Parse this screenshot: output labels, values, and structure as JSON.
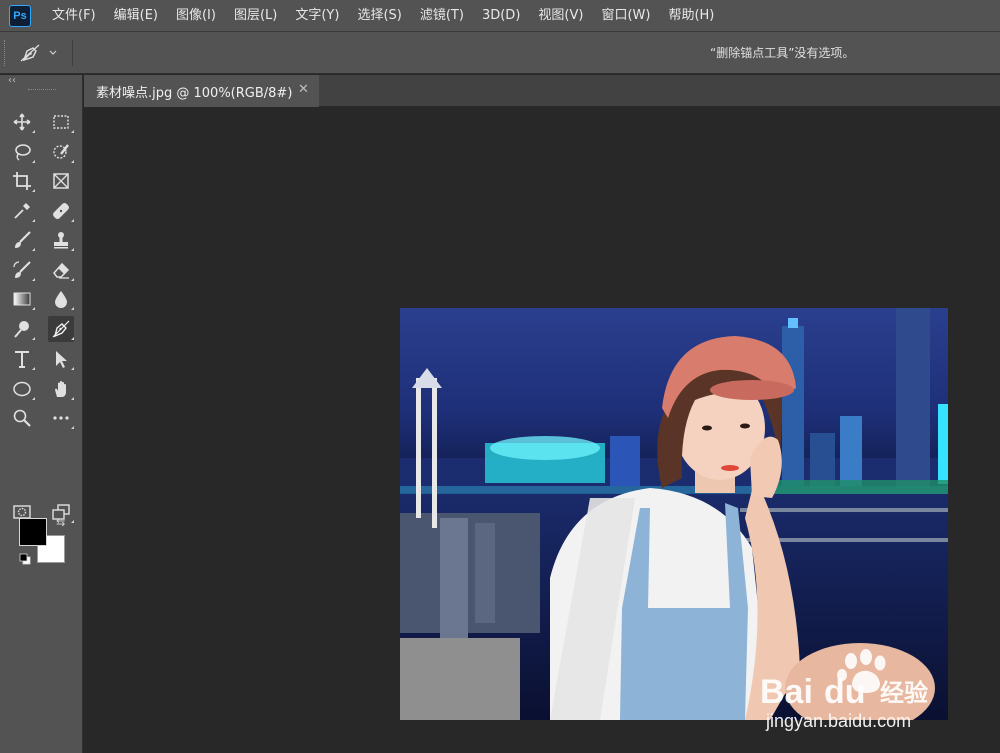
{
  "app": {
    "logo_text": "Ps"
  },
  "menu": [
    {
      "label": "文件(F)"
    },
    {
      "label": "编辑(E)"
    },
    {
      "label": "图像(I)"
    },
    {
      "label": "图层(L)"
    },
    {
      "label": "文字(Y)"
    },
    {
      "label": "选择(S)"
    },
    {
      "label": "滤镜(T)"
    },
    {
      "label": "3D(D)"
    },
    {
      "label": "视图(V)"
    },
    {
      "label": "窗口(W)"
    },
    {
      "label": "帮助(H)"
    }
  ],
  "options_bar": {
    "tool_icon": "pen-tool-icon",
    "message": "“删除锚点工具”没有选项。"
  },
  "toolbar": {
    "collapse_label": "‹‹",
    "tools": [
      "move-tool-icon",
      "marquee-tool-icon",
      "lasso-tool-icon",
      "quick-select-tool-icon",
      "crop-tool-icon",
      "frame-tool-icon",
      "eyedropper-tool-icon",
      "healing-brush-tool-icon",
      "brush-tool-icon",
      "clone-stamp-tool-icon",
      "history-brush-tool-icon",
      "eraser-tool-icon",
      "gradient-tool-icon",
      "blur-tool-icon",
      "dodge-tool-icon",
      "pen-tool-icon",
      "type-tool-icon",
      "path-selection-tool-icon",
      "ellipse-tool-icon",
      "hand-tool-icon",
      "zoom-tool-icon",
      "more-tools-icon",
      "quick-mask-icon",
      "screen-mode-icon"
    ],
    "active_tool": "pen-tool-icon",
    "foreground_color": "#000000",
    "background_color": "#ffffff",
    "swap_glyph": "⇆"
  },
  "document": {
    "tab_title": "素材噪点.jpg @ 100%(RGB/8#)",
    "close_glyph": "✕"
  },
  "watermark": {
    "brand": "Bai",
    "brand_suffix": "经验",
    "url": "jingyan.baidu.com"
  },
  "colors": {
    "panel": "#535353",
    "canvas": "#282828",
    "accent": "#31a8ff"
  }
}
